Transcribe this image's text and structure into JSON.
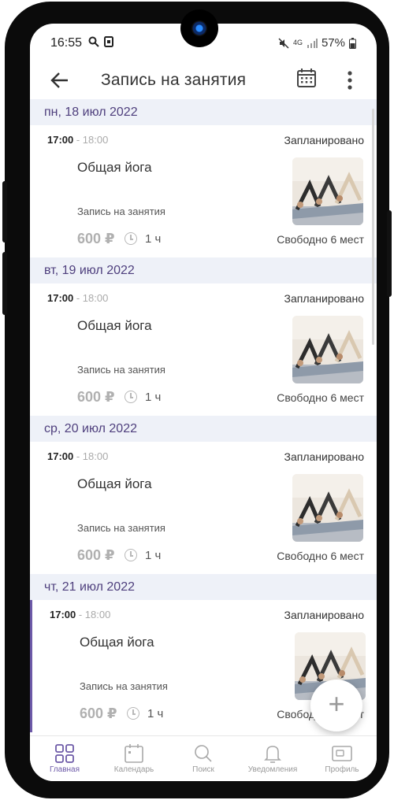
{
  "status_bar": {
    "time": "16:55",
    "network": "4G",
    "battery": "57%"
  },
  "app_bar": {
    "title": "Запись на занятия"
  },
  "days": [
    {
      "date": "пн, 18 июл 2022",
      "card": {
        "time_start": "17:00",
        "time_end": " - 18:00",
        "status": "Запланировано",
        "title": "Общая йога",
        "kind": "Запись на занятия",
        "price": "600 ₽",
        "duration": "1 ч",
        "free": "Свободно 6 мест"
      }
    },
    {
      "date": "вт, 19 июл 2022",
      "card": {
        "time_start": "17:00",
        "time_end": " - 18:00",
        "status": "Запланировано",
        "title": "Общая йога",
        "kind": "Запись на занятия",
        "price": "600 ₽",
        "duration": "1 ч",
        "free": "Свободно 6 мест"
      }
    },
    {
      "date": "ср, 20 июл 2022",
      "card": {
        "time_start": "17:00",
        "time_end": " - 18:00",
        "status": "Запланировано",
        "title": "Общая йога",
        "kind": "Запись на занятия",
        "price": "600 ₽",
        "duration": "1 ч",
        "free": "Свободно 6 мест"
      }
    },
    {
      "date": "чт, 21 июл 2022",
      "card": {
        "time_start": "17:00",
        "time_end": " - 18:00",
        "status": "Запланировано",
        "title": "Общая йога",
        "kind": "Запись на занятия",
        "price": "600 ₽",
        "duration": "1 ч",
        "free": "Свободно 6 мест"
      }
    }
  ],
  "fab": {
    "label": "+"
  },
  "bottom_nav": [
    {
      "label": "Главная",
      "icon": "grid-icon"
    },
    {
      "label": "Календарь",
      "icon": "calendar-icon"
    },
    {
      "label": "Поиск",
      "icon": "search-icon"
    },
    {
      "label": "Уведомления",
      "icon": "bell-icon"
    },
    {
      "label": "Профиль",
      "icon": "profile-card-icon"
    }
  ],
  "colors": {
    "accent": "#6d5aa8",
    "day_header_bg": "#eef1f8",
    "day_header_text": "#4e3f7d"
  }
}
